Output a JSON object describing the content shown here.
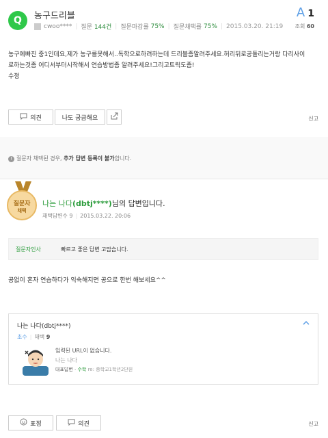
{
  "question": {
    "badge": "Q",
    "title": "농구드리블",
    "author": "cwoo****",
    "question_label": "질문",
    "question_count": "144건",
    "close_label": "질문마감률",
    "close_rate": "75%",
    "adopt_label": "질문채택률",
    "adopt_rate": "75%",
    "date": "2015.03.20. 21:19",
    "answer_letter": "A",
    "answer_count": "1",
    "views_label": "조회",
    "views": "60",
    "body_lines": [
      "농구에빠진 중1인데요,제가 농구를못해서..독학으로하려하는데 드리블좀알려주세요.허리뒤로공돌리는거랑 다리사이",
      "로하는것좀 어디서부터시작해서 연습방법좀 알려주세요!그리고트릭도좀!",
      "수정"
    ],
    "opinion_button": "의견",
    "curious_button": "나도 궁금해요",
    "report": "신고"
  },
  "notice": {
    "prefix": "질문자 채택된 경우,",
    "bold": "추가 답변 등록이 불가",
    "suffix": "합니다."
  },
  "answer": {
    "medal_line1": "질문자",
    "medal_line2": "채택",
    "name_plain": "나는 나다",
    "name_id": "(dbtj****)",
    "title_suffix": "님의 답변입니다.",
    "adopt_label": "채택답변수",
    "adopt_count": "9",
    "date": "2015.03.22. 20:06",
    "thanks_label": "질문자인사",
    "thanks_msg": "빠르고 좋은 답변 고맙습니다.",
    "body": "공없이 혼자 연습하다가 익숙해지면 공으로 한번 해보세요^^",
    "card": {
      "name": "나는 나다(dbtj****)",
      "level": "초수",
      "adopt_label": "채택",
      "adopt_count": "9",
      "msg1": "입력된 URL이 없습니다.",
      "msg2": "나는 나다",
      "msg3_label": "대표답변",
      "msg3_link": "수학",
      "msg3_rest": "re: 중학교1학년2단원"
    },
    "expression_button": "표정",
    "opinion_button": "의견",
    "report": "신고"
  },
  "colors": {
    "green": "#2fc84a",
    "blue": "#5b9ee6"
  }
}
